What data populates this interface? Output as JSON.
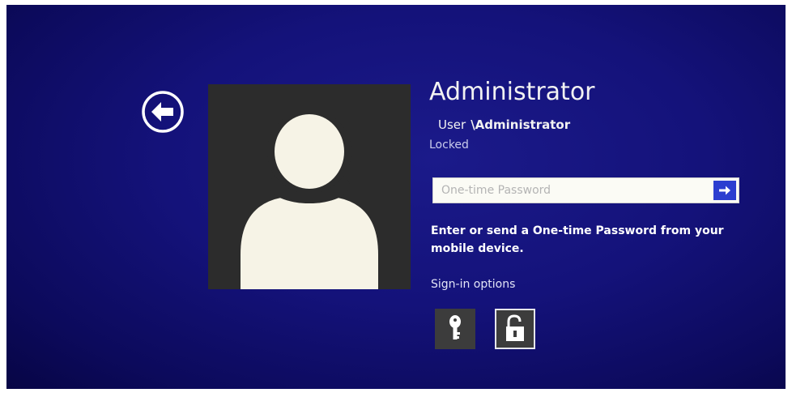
{
  "user": {
    "display_name": "Administrator",
    "account_prefix": "User",
    "account_name": "\\Administrator",
    "status": "Locked"
  },
  "password": {
    "placeholder": "One-time Password",
    "value": "",
    "help_text": "Enter or send a One-time Password from your mobile device."
  },
  "sign_in_options": {
    "label": "Sign-in options",
    "items": [
      {
        "icon": "key-icon",
        "selected": false
      },
      {
        "icon": "padlock-icon",
        "selected": true
      }
    ]
  },
  "colors": {
    "background": "#14127a",
    "accent": "#2c3ed0",
    "avatar_bg": "#2c2c2c",
    "tile_bg": "#3c3c3c"
  }
}
